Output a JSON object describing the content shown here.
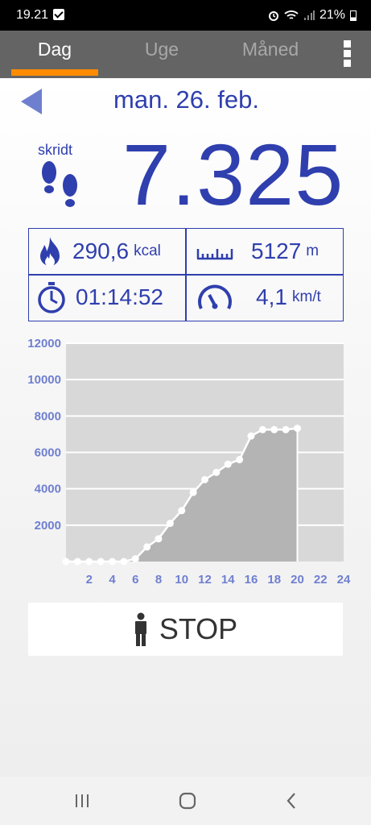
{
  "status_bar": {
    "time": "19.21",
    "battery": "21%"
  },
  "tabs": [
    {
      "label": "Dag",
      "active": true
    },
    {
      "label": "Uge",
      "active": false
    },
    {
      "label": "Måned",
      "active": false
    }
  ],
  "header": {
    "date": "man. 26. feb."
  },
  "steps": {
    "label": "skridt",
    "value": "7.325"
  },
  "stats": {
    "calories": {
      "value": "290,6",
      "unit": "kcal"
    },
    "distance": {
      "value": "5127",
      "unit": "m"
    },
    "duration": {
      "value": "01:14:52"
    },
    "speed": {
      "value": "4,1",
      "unit": "km/t"
    }
  },
  "chart_data": {
    "type": "area",
    "x": [
      0,
      1,
      2,
      3,
      4,
      5,
      6,
      7,
      8,
      9,
      10,
      11,
      12,
      13,
      14,
      15,
      16,
      17,
      18,
      19,
      20
    ],
    "values": [
      0,
      0,
      0,
      0,
      0,
      0,
      150,
      800,
      1250,
      2100,
      2800,
      3800,
      4500,
      4900,
      5350,
      5600,
      6900,
      7250,
      7250,
      7250,
      7325
    ],
    "ylim": [
      0,
      12000
    ],
    "xlim": [
      0,
      24
    ],
    "yticks": [
      2000,
      4000,
      6000,
      8000,
      10000,
      12000
    ],
    "xticks": [
      2,
      4,
      6,
      8,
      10,
      12,
      14,
      16,
      18,
      20,
      22,
      24
    ],
    "current_hour": 20,
    "grid": true
  },
  "actions": {
    "stop_label": "STOP"
  },
  "colors": {
    "accent": "#2f3fae",
    "tab_indicator": "#ff8c00",
    "tabbar": "#646464"
  }
}
